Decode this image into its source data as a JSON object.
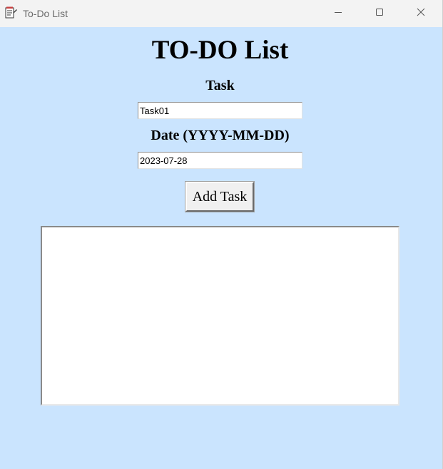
{
  "window": {
    "title": "To-Do List",
    "controls": {
      "minimize_icon": "minimize-icon",
      "maximize_icon": "maximize-icon",
      "close_icon": "close-icon"
    }
  },
  "app": {
    "heading": "TO-DO List",
    "task_label": "Task",
    "task_value": "Task01",
    "date_label": "Date (YYYY-MM-DD)",
    "date_value": "2023-07-28",
    "add_button_label": "Add Task",
    "tasks": []
  },
  "colors": {
    "background": "#cae4fe",
    "titlebar": "#f3f3f3",
    "field_background": "#ffffff",
    "button_face": "#f0f0f0"
  }
}
